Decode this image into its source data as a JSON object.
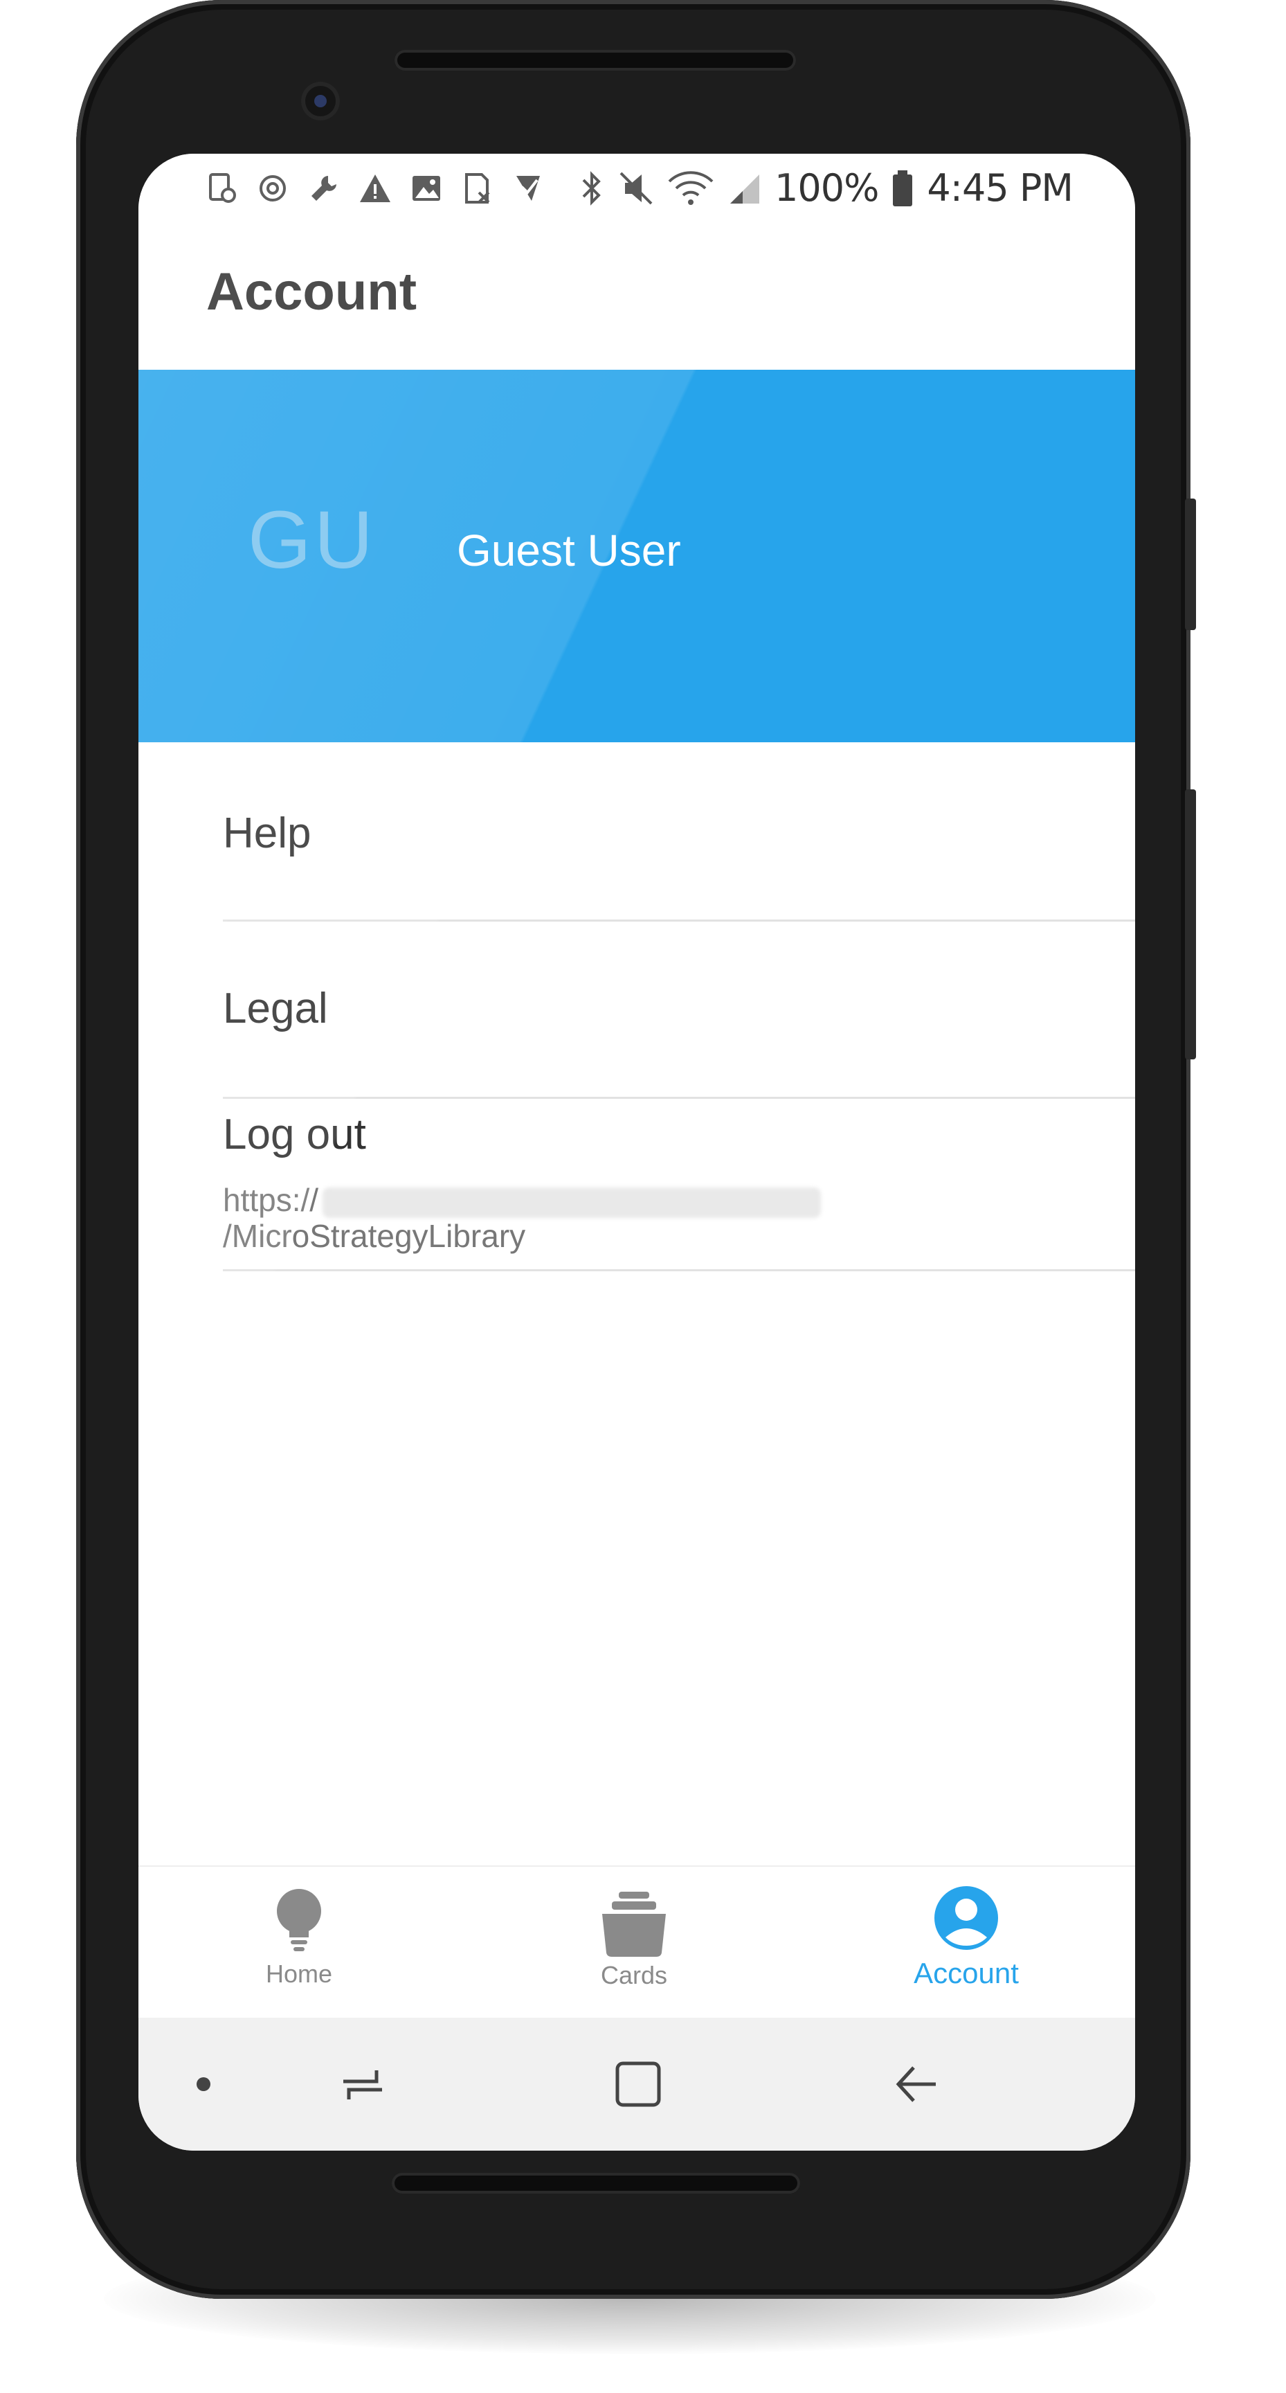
{
  "status_bar": {
    "battery_percent": "100%",
    "time": "4:45 PM",
    "left_icons": [
      "screenshot-icon",
      "sync-icon",
      "wrench-icon",
      "warning-icon",
      "image-icon",
      "sim-icon",
      "check-icon"
    ],
    "right_icons": [
      "bluetooth-icon",
      "mute-icon",
      "wifi-icon",
      "signal-icon",
      "battery-icon"
    ]
  },
  "app_bar": {
    "title": "Account"
  },
  "profile": {
    "initials": "GU",
    "name": "Guest User",
    "banner_color": "#27a4eb"
  },
  "menu": {
    "help": "Help",
    "legal": "Legal",
    "logout": {
      "label": "Log out",
      "url_prefix": "https://",
      "url_path": "/MicroStrategyLibrary"
    }
  },
  "tabs": [
    {
      "label": "Home",
      "icon": "lightbulb-icon",
      "active": false
    },
    {
      "label": "Cards",
      "icon": "cards-stack-icon",
      "active": false
    },
    {
      "label": "Account",
      "icon": "account-circle-icon",
      "active": true
    }
  ],
  "accent_color": "#27a4eb"
}
